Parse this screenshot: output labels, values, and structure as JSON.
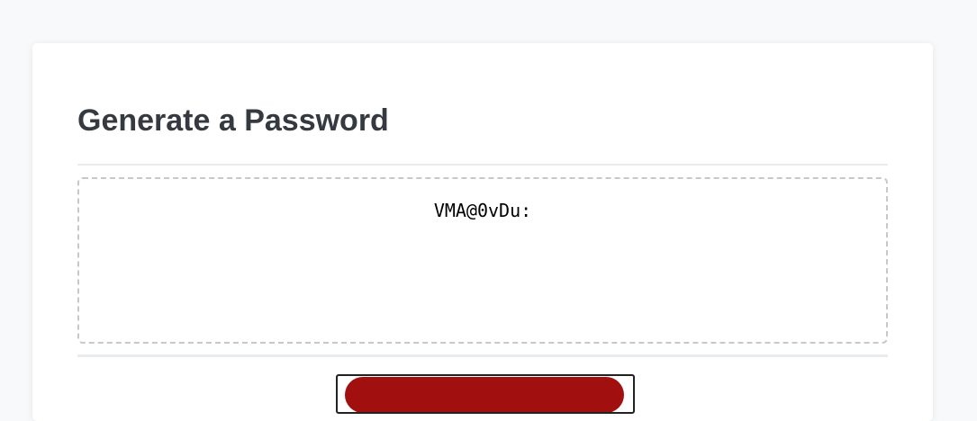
{
  "header": {
    "title": "Generate a Password"
  },
  "password": {
    "value": "VMA@0vDu:"
  },
  "colors": {
    "background": "#f8f9fa",
    "card": "#ffffff",
    "title": "#343a40",
    "button": "#a10f0f"
  }
}
